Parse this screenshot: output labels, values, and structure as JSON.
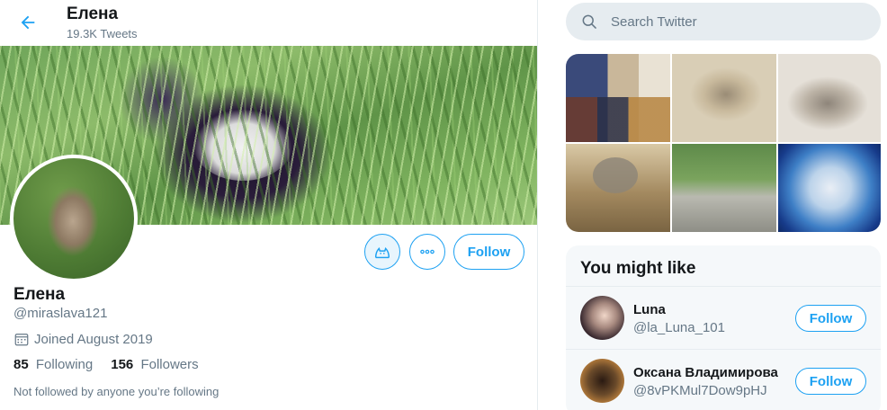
{
  "colors": {
    "accent": "#1da1f2",
    "text": "#14171a",
    "secondary_text": "#657786",
    "search_bg": "#e6ecf0"
  },
  "header": {
    "back_icon": "arrow-left-icon",
    "name": "Елена",
    "tweet_count": "19.3K Tweets"
  },
  "profile": {
    "name": "Елена",
    "handle": "@miraslava121",
    "joined_icon": "calendar-icon",
    "joined": "Joined August 2019",
    "following_count": "85",
    "following_label": "Following",
    "followers_count": "156",
    "followers_label": "Followers",
    "followed_by": "Not followed by anyone you’re following",
    "actions": {
      "cat_icon": "cat-icon",
      "more_icon": "more-icon",
      "follow_label": "Follow"
    }
  },
  "sidebar": {
    "search": {
      "icon": "search-icon",
      "placeholder": "Search Twitter"
    },
    "you_might_like": {
      "title": "You might like",
      "users": [
        {
          "name": "Luna",
          "handle": "@la_Luna_101",
          "follow_label": "Follow"
        },
        {
          "name": "Оксана Владимирова",
          "handle": "@8vPKMul7Dow9pHJ",
          "follow_label": "Follow"
        }
      ]
    }
  }
}
